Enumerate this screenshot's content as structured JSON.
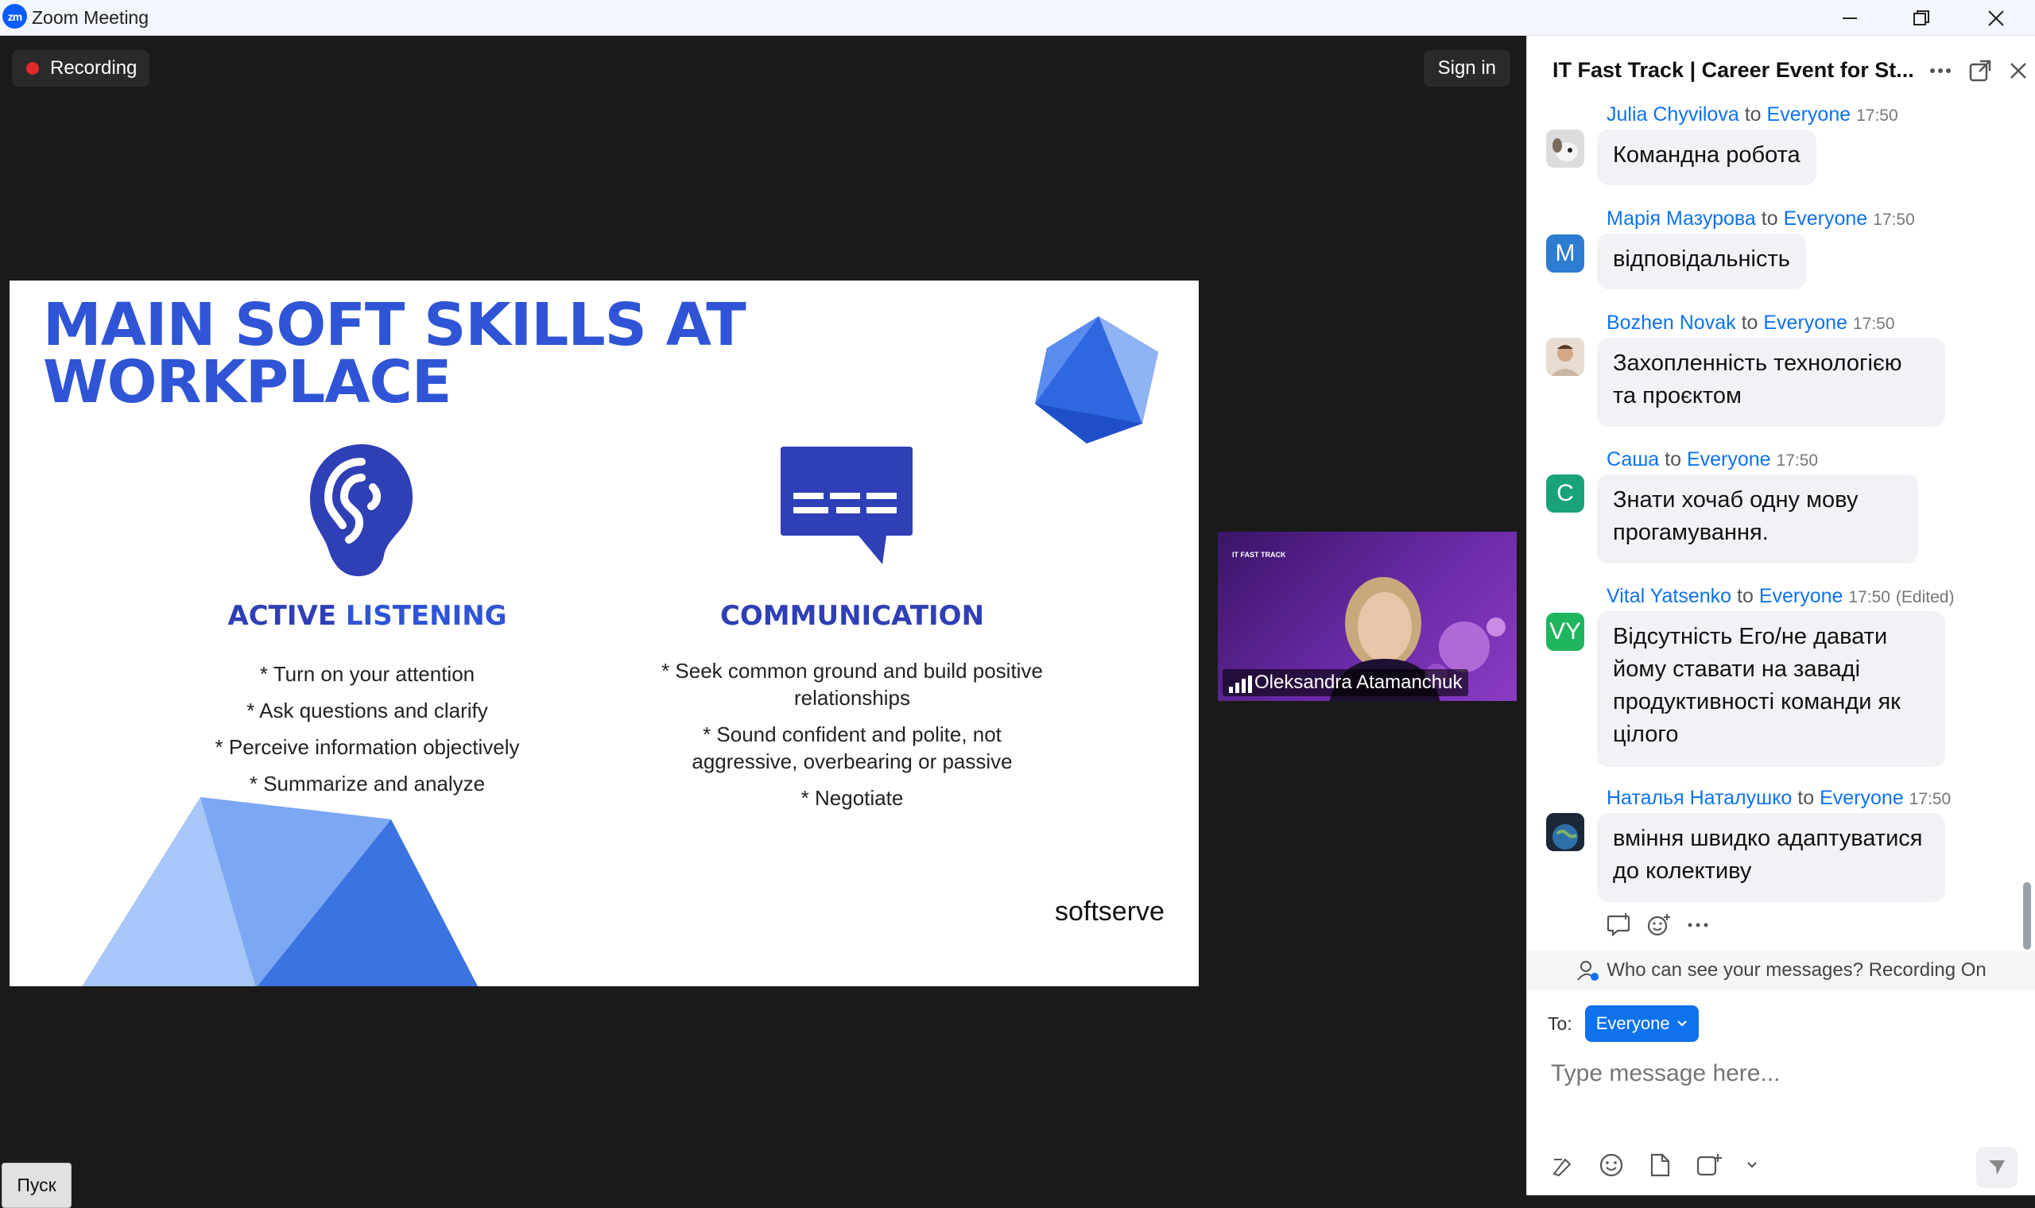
{
  "window": {
    "title": "Zoom Meeting",
    "logo_text": "zm"
  },
  "meeting": {
    "recording_label": "Recording",
    "sign_in_label": "Sign in",
    "pusk_label": "Пуск"
  },
  "slide": {
    "title_line1": "MAIN SOFT SKILLS AT",
    "title_line2": "WORKPLACE",
    "left": {
      "title_a": "ACTIVE ",
      "title_b": "LISTENING",
      "bullets": [
        "* Turn on your attention",
        "* Ask questions and clarify",
        "* Perceive information objectively",
        "* Summarize and analyze"
      ]
    },
    "right": {
      "title": "COMMUNICATION",
      "bullets": [
        "* Seek common ground and build positive",
        "relationships",
        "* Sound confident and polite, not",
        "aggressive, overbearing or passive",
        "* Negotiate"
      ]
    },
    "brand": "softserve"
  },
  "participant": {
    "name": "Oleksandra Atamanchuk",
    "brand": "IT FAST TRACK"
  },
  "chat": {
    "title": "IT Fast Track | Career Event for St...",
    "to_word": "to",
    "messages": [
      {
        "sender": "Julia Chyvilova",
        "recipient": "Everyone",
        "time": "17:50",
        "edited": "",
        "avatar_letter": "",
        "avatar_color": "#d9d9d9",
        "lines": [
          "Командна робота"
        ]
      },
      {
        "sender": "Марія Мазурова",
        "recipient": "Everyone",
        "time": "17:50",
        "edited": "",
        "avatar_letter": "M",
        "avatar_color": "#2d7cd1",
        "lines": [
          "відповідальність"
        ]
      },
      {
        "sender": "Bozhen Novak",
        "recipient": "Everyone",
        "time": "17:50",
        "edited": "",
        "avatar_letter": "",
        "avatar_color": "#c9b6a4",
        "lines": [
          "Захопленність технологією",
          "та проєктом"
        ]
      },
      {
        "sender": "Саша",
        "recipient": "Everyone",
        "time": "17:50",
        "edited": "",
        "avatar_letter": "C",
        "avatar_color": "#1aa37a",
        "lines": [
          "Знати хочаб одну мову",
          "прогамування."
        ]
      },
      {
        "sender": "Vital Yatsenko",
        "recipient": "Everyone",
        "time": "17:50",
        "edited": "(Edited)",
        "avatar_letter": "VY",
        "avatar_color": "#1fb55e",
        "lines": [
          "Відсутність Его/не давати",
          "йому ставати на заваді",
          "продуктивності команди як",
          "цілого"
        ]
      },
      {
        "sender": "Наталья Наталушко",
        "recipient": "Everyone",
        "time": "17:50",
        "edited": "",
        "avatar_letter": "",
        "avatar_color": "#3a4a5a",
        "lines": [
          "вміння швидко адаптуватися",
          "до колективу"
        ]
      }
    ],
    "privacy_notice": "Who can see your messages? Recording On",
    "to_label": "To:",
    "recipient_button": "Everyone",
    "compose_placeholder": "Type message here..."
  },
  "colors": {
    "accent": "#0e72ed",
    "slide_blue": "#2f54d6",
    "record_red": "#e0282e"
  }
}
